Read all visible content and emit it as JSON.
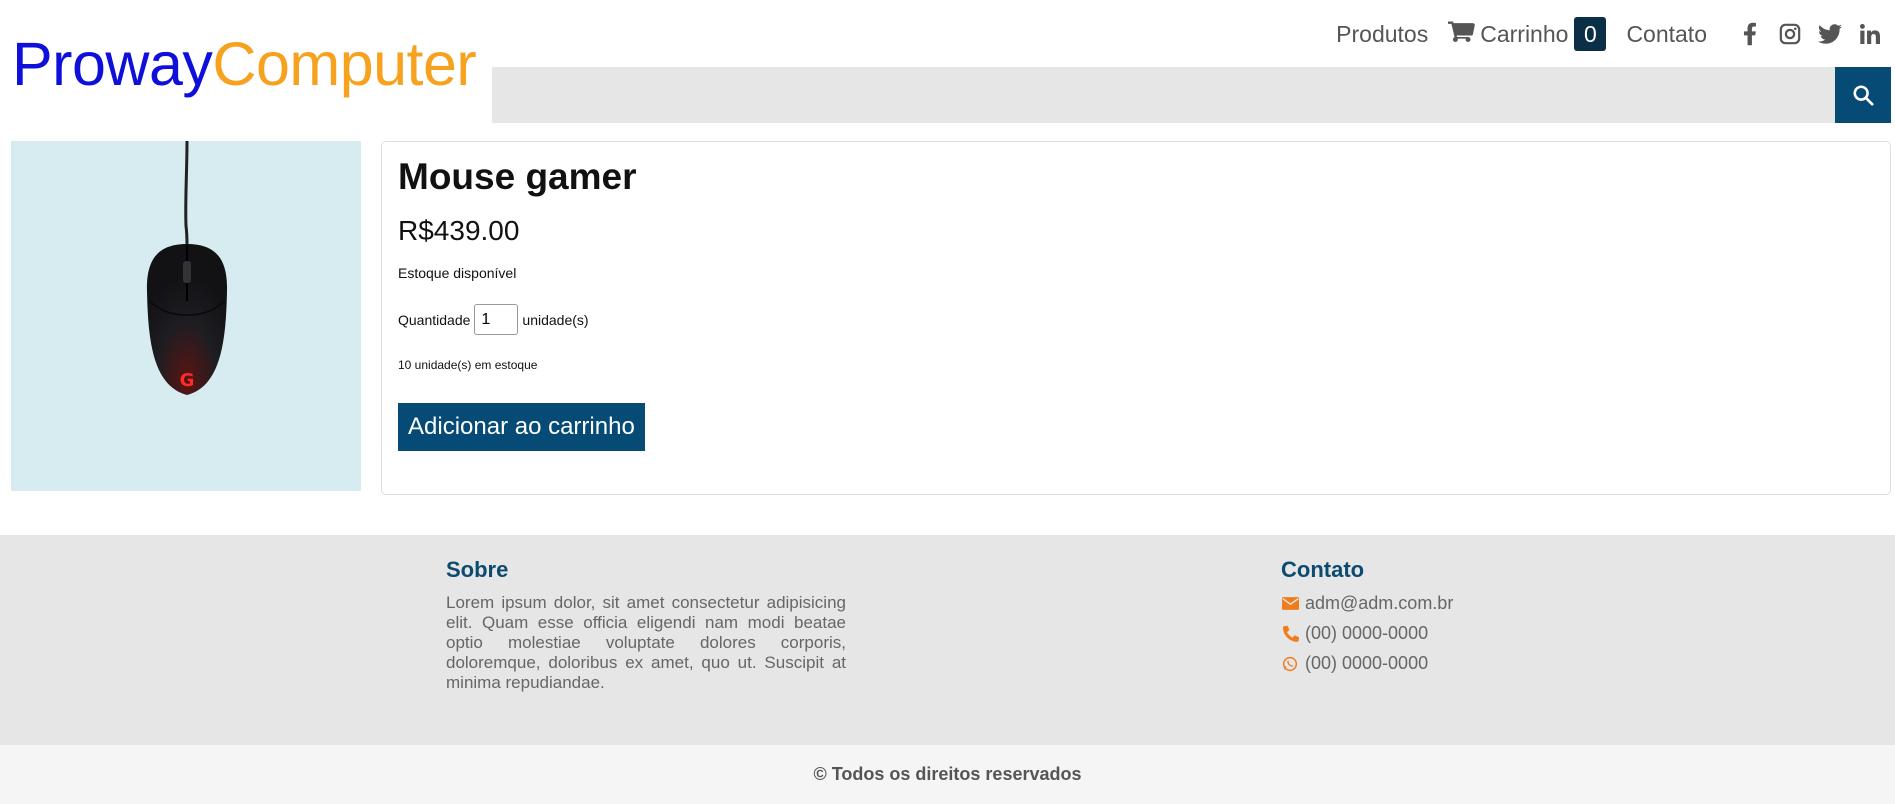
{
  "brand": {
    "part1": "Proway",
    "part2": "Computer"
  },
  "nav": {
    "produtos": "Produtos",
    "carrinho": "Carrinho",
    "cart_count": "0",
    "contato": "Contato",
    "social": [
      "facebook-icon",
      "instagram-icon",
      "twitter-icon",
      "linkedin-icon"
    ]
  },
  "search": {
    "placeholder": "",
    "value": ""
  },
  "product": {
    "title": "Mouse gamer",
    "price": "R$439.00",
    "availability": "Estoque disponível",
    "quantity_label": "Quantidade",
    "quantity_value": "1",
    "quantity_unit": "unidade(s)",
    "stock_text": "10 unidade(s) em estoque",
    "add_button": "Adicionar ao carrinho"
  },
  "footer": {
    "about_title": "Sobre",
    "about_text": "Lorem ipsum dolor, sit amet consectetur adipisicing elit. Quam esse officia eligendi nam modi beatae optio molestiae voluptate dolores corporis, doloremque, doloribus ex amet, quo ut. Suscipit at minima repudiandae.",
    "contact_title": "Contato",
    "email": "adm@adm.com.br",
    "phone": "(00) 0000-0000",
    "whatsapp": "(00) 0000-0000",
    "copyright": "© Todos os direitos reservados"
  },
  "colors": {
    "brand_blue": "#0f0fdc",
    "brand_orange": "#f6a21e",
    "primary": "#064a76",
    "badge": "#0c2f48",
    "footer_title": "#0c4a70",
    "icon_orange": "#f07c1c"
  }
}
